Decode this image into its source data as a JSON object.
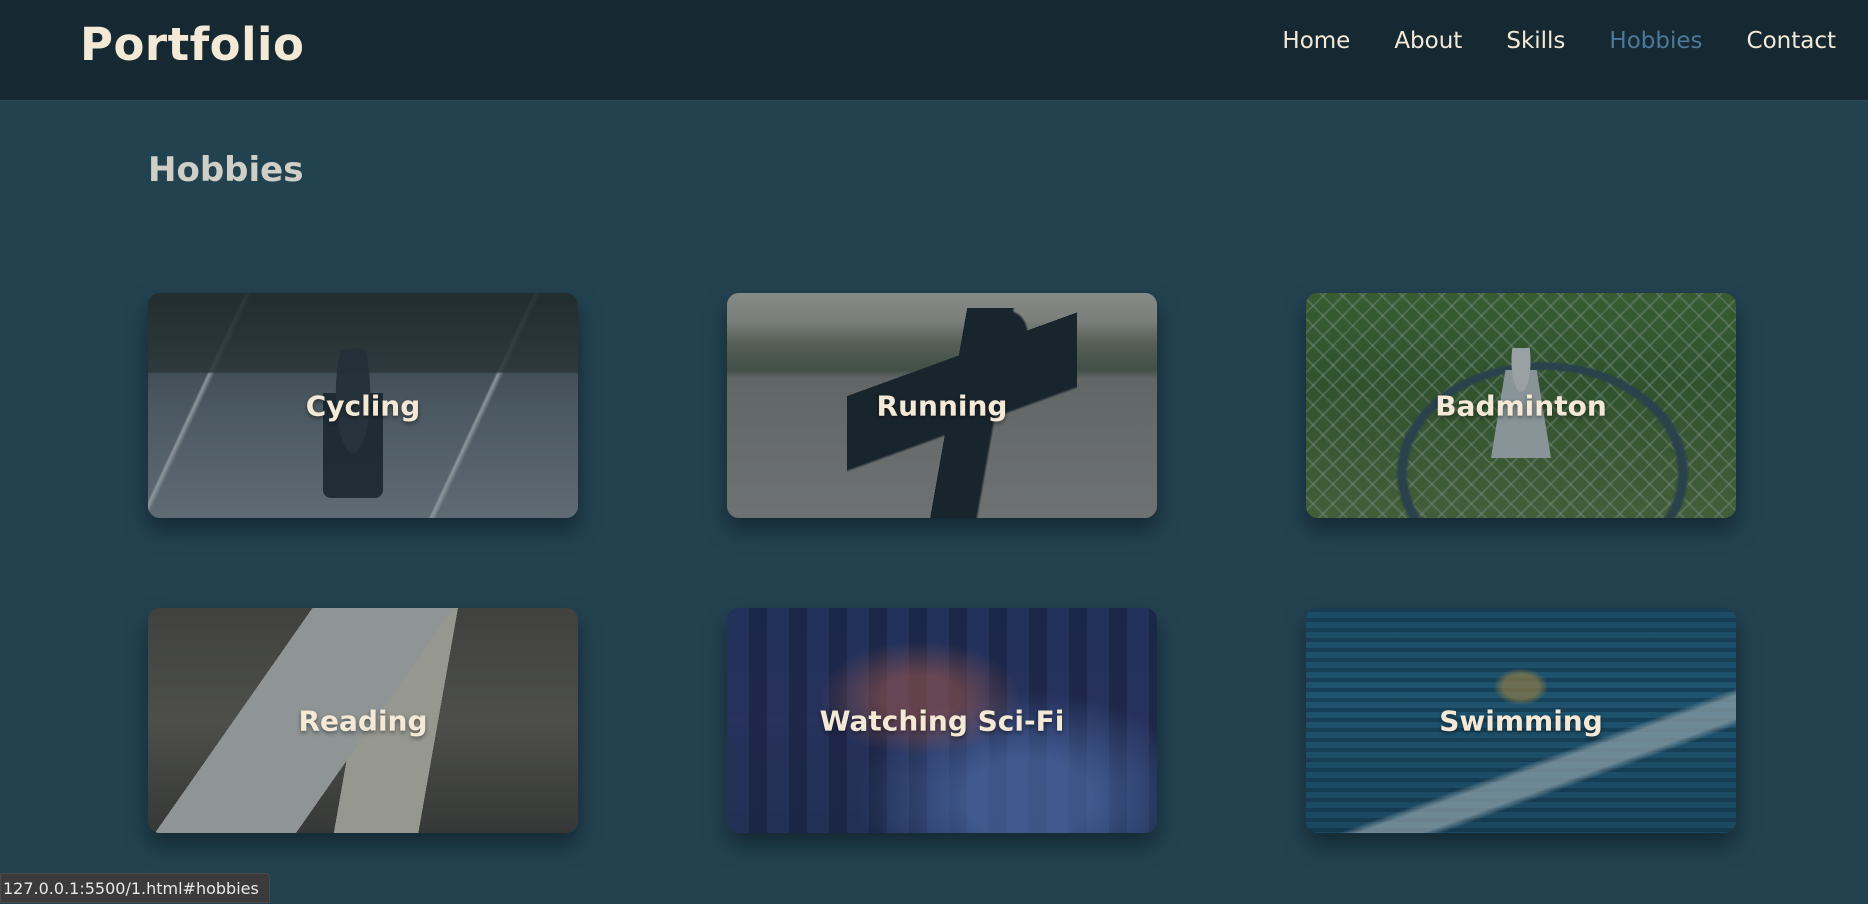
{
  "header": {
    "brand": "Portfolio",
    "nav": [
      {
        "label": "Home",
        "active": false
      },
      {
        "label": "About",
        "active": false
      },
      {
        "label": "Skills",
        "active": false
      },
      {
        "label": "Hobbies",
        "active": true
      },
      {
        "label": "Contact",
        "active": false
      }
    ]
  },
  "main": {
    "title": "Hobbies",
    "hobbies": [
      {
        "label": "Cycling"
      },
      {
        "label": "Running"
      },
      {
        "label": "Badminton"
      },
      {
        "label": "Reading"
      },
      {
        "label": "Watching Sci-Fi"
      },
      {
        "label": "Swimming"
      }
    ]
  },
  "status": {
    "url": "127.0.0.1:5500/1.html#hobbies"
  },
  "colors": {
    "background": "#234250",
    "navbar": "#162932",
    "text": "#f4e9d7",
    "active_link": "#4c789b"
  }
}
